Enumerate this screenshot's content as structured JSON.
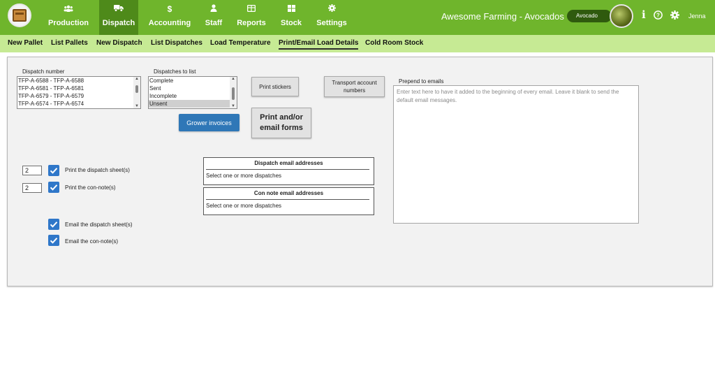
{
  "nav": {
    "items": [
      {
        "label": "Production",
        "icon": "users-icon"
      },
      {
        "label": "Dispatch",
        "icon": "truck-icon",
        "active": true
      },
      {
        "label": "Accounting",
        "icon": "dollar-icon"
      },
      {
        "label": "Staff",
        "icon": "person-icon"
      },
      {
        "label": "Reports",
        "icon": "report-icon"
      },
      {
        "label": "Stock",
        "icon": "grid-icon"
      },
      {
        "label": "Settings",
        "icon": "gear-icon"
      }
    ],
    "brand": "Awesome Farming - Avocados",
    "crop": "Avocado",
    "user": "Jenna"
  },
  "subnav": {
    "items": [
      "New Pallet",
      "List Pallets",
      "New Dispatch",
      "List Dispatches",
      "Load Temperature",
      "Print/Email Load Details",
      "Cold Room Stock"
    ],
    "active_index": 5
  },
  "form": {
    "dispatch_number_label": "Dispatch number",
    "dispatch_numbers": [
      "TFP-A-6588 - TFP-A-6588",
      "TFP-A-6581 - TFP-A-6581",
      "TFP-A-6579 - TFP-A-6579",
      "TFP-A-6574 - TFP-A-6574"
    ],
    "dispatches_to_list_label": "Dispatches to list",
    "dispatch_filters": [
      "Complete",
      "Sent",
      "Incomplete",
      "Unsent"
    ],
    "dispatch_filter_selected": "Unsent",
    "print_stickers": "Print stickers",
    "transport_account_numbers_1": "Transport account",
    "transport_account_numbers_2": "numbers",
    "grower_invoices": "Grower invoices",
    "print_email_forms_1": "Print and/or",
    "print_email_forms_2": "email forms",
    "prepend_label": "Prepend to emails",
    "prepend_placeholder": "Enter text here to have it added to the beginning of every email. Leave it blank to send the default email messages.",
    "print_dispatch_count": "2",
    "print_dispatch_label": "Print the dispatch sheet(s)",
    "print_dispatch_checked": true,
    "print_connote_count": "2",
    "print_connote_label": "Print the con-note(s)",
    "print_connote_checked": true,
    "email_dispatch_label": "Email the dispatch sheet(s)",
    "email_dispatch_checked": true,
    "email_connote_label": "Email the con-note(s)",
    "email_connote_checked": true,
    "dispatch_email_title": "Dispatch email addresses",
    "dispatch_email_body": "Select one or more dispatches",
    "connote_email_title": "Con note email addresses",
    "connote_email_body": "Select one or more dispatches"
  },
  "colors": {
    "nav_bg": "#6fb52c",
    "nav_active": "#4e8a1a",
    "subnav_bg": "#c6ea94",
    "button_blue": "#2f77b7",
    "checkbox_blue": "#2f77c9"
  }
}
